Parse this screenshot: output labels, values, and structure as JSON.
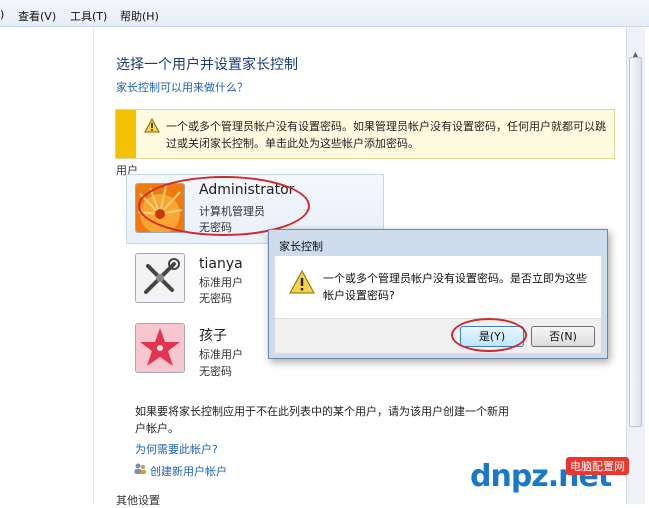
{
  "menu": {
    "edit_tail": ")",
    "view": "查看(V)",
    "tools": "工具(T)",
    "help": "帮助(H)"
  },
  "page": {
    "title": "选择一个用户并设置家长控制",
    "help_link": "家长控制可以用来做什么？",
    "warning": "一个或多个管理员帐户没有设置密码。如果管理员帐户没有设置密码，任何用户就都可以跳过或关闭家长控制。单击此处为这些帐户添加密码。",
    "users_label": "用户",
    "explain": "如果要将家长控制应用于不在此列表中的某个用户，请为该用户创建一个新用户帐户。",
    "why_link": "为何需要此帐户?",
    "create_link": "创建新用户帐户",
    "other_settings": "其他设置"
  },
  "users": [
    {
      "name": "Administrator",
      "role": "计算机管理员",
      "password": "无密码"
    },
    {
      "name": "tianya",
      "role": "标准用户",
      "password": "无密码"
    },
    {
      "name": "孩子",
      "role": "标准用户",
      "password": "无密码"
    }
  ],
  "dialog": {
    "title": "家长控制",
    "message": "一个或多个管理员帐户没有设置密码。是否立即为这些帐户设置密码?",
    "yes": "是(Y)",
    "no": "否(N)"
  },
  "watermark": {
    "brand": "dnpz.net",
    "label": "电脑配置网"
  },
  "colors": {
    "link": "#1f63b5",
    "title": "#1a3c74",
    "warning_bar": "#f2c200",
    "annotation_red": "#d02a2a"
  }
}
